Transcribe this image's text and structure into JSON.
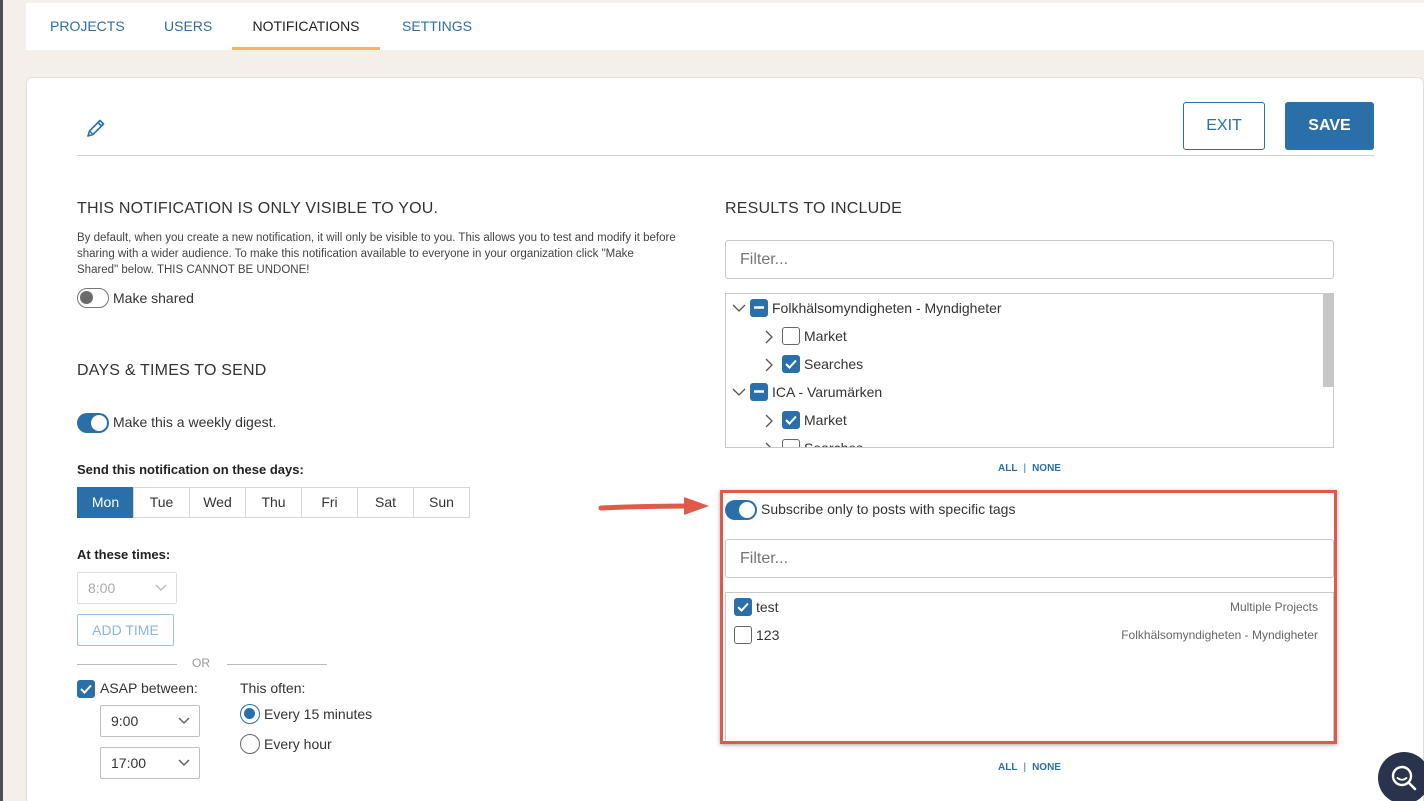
{
  "tabs": [
    {
      "label": "PROJECTS",
      "active": false
    },
    {
      "label": "USERS",
      "active": false
    },
    {
      "label": "NOTIFICATIONS",
      "active": true
    },
    {
      "label": "SETTINGS",
      "active": false
    }
  ],
  "header": {
    "edit_icon": "pencil-icon",
    "exit_label": "EXIT",
    "save_label": "SAVE"
  },
  "visibility": {
    "title": "THIS NOTIFICATION IS ONLY VISIBLE TO YOU.",
    "description": "By default, when you create a new notification, it will only be visible to you. This allows you to test and modify it before sharing with a wider audience. To make this notification available to everyone in your organization click \"Make Shared\" below. THIS CANNOT BE UNDONE!",
    "make_shared_label": "Make shared",
    "make_shared_on": false
  },
  "schedule": {
    "title": "DAYS & TIMES TO SEND",
    "weekly_digest_label": "Make this a weekly digest.",
    "weekly_digest_on": true,
    "days_label": "Send this notification on these days:",
    "days": [
      {
        "label": "Mon",
        "active": true
      },
      {
        "label": "Tue",
        "active": false
      },
      {
        "label": "Wed",
        "active": false
      },
      {
        "label": "Thu",
        "active": false
      },
      {
        "label": "Fri",
        "active": false
      },
      {
        "label": "Sat",
        "active": false
      },
      {
        "label": "Sun",
        "active": false
      }
    ],
    "times_label": "At these times:",
    "time_value": "8:00",
    "add_time_label": "ADD TIME",
    "or_label": "OR",
    "asap_label": "ASAP between:",
    "asap_checked": true,
    "asap_from": "9:00",
    "asap_to": "17:00",
    "often_label": "This often:",
    "often_options": [
      {
        "label": "Every 15 minutes",
        "selected": true
      },
      {
        "label": "Every hour",
        "selected": false
      }
    ]
  },
  "results": {
    "title": "RESULTS TO INCLUDE",
    "filter_placeholder": "Filter...",
    "tree": [
      {
        "label": "Folkhälsomyndigheten - Myndigheter",
        "level": 0,
        "state": "partial"
      },
      {
        "label": "Market",
        "level": 1,
        "state": "unchecked"
      },
      {
        "label": "Searches",
        "level": 1,
        "state": "checked"
      },
      {
        "label": "ICA - Varumärken",
        "level": 0,
        "state": "partial"
      },
      {
        "label": "Market",
        "level": 1,
        "state": "checked"
      },
      {
        "label": "Searches",
        "level": 1,
        "state": "unchecked"
      }
    ],
    "all_label": "ALL",
    "none_label": "NONE"
  },
  "tags": {
    "subscribe_label": "Subscribe only to posts with specific tags",
    "subscribe_on": true,
    "filter_placeholder": "Filter...",
    "items": [
      {
        "label": "test",
        "project": "Multiple Projects",
        "checked": true
      },
      {
        "label": "123",
        "project": "Folkhälsomyndigheten - Myndigheter",
        "checked": false
      }
    ],
    "all_label": "ALL",
    "none_label": "NONE"
  },
  "colors": {
    "accent": "#2a6fa8",
    "highlight": "#e05a4a",
    "tab_underline": "#f0b570"
  }
}
